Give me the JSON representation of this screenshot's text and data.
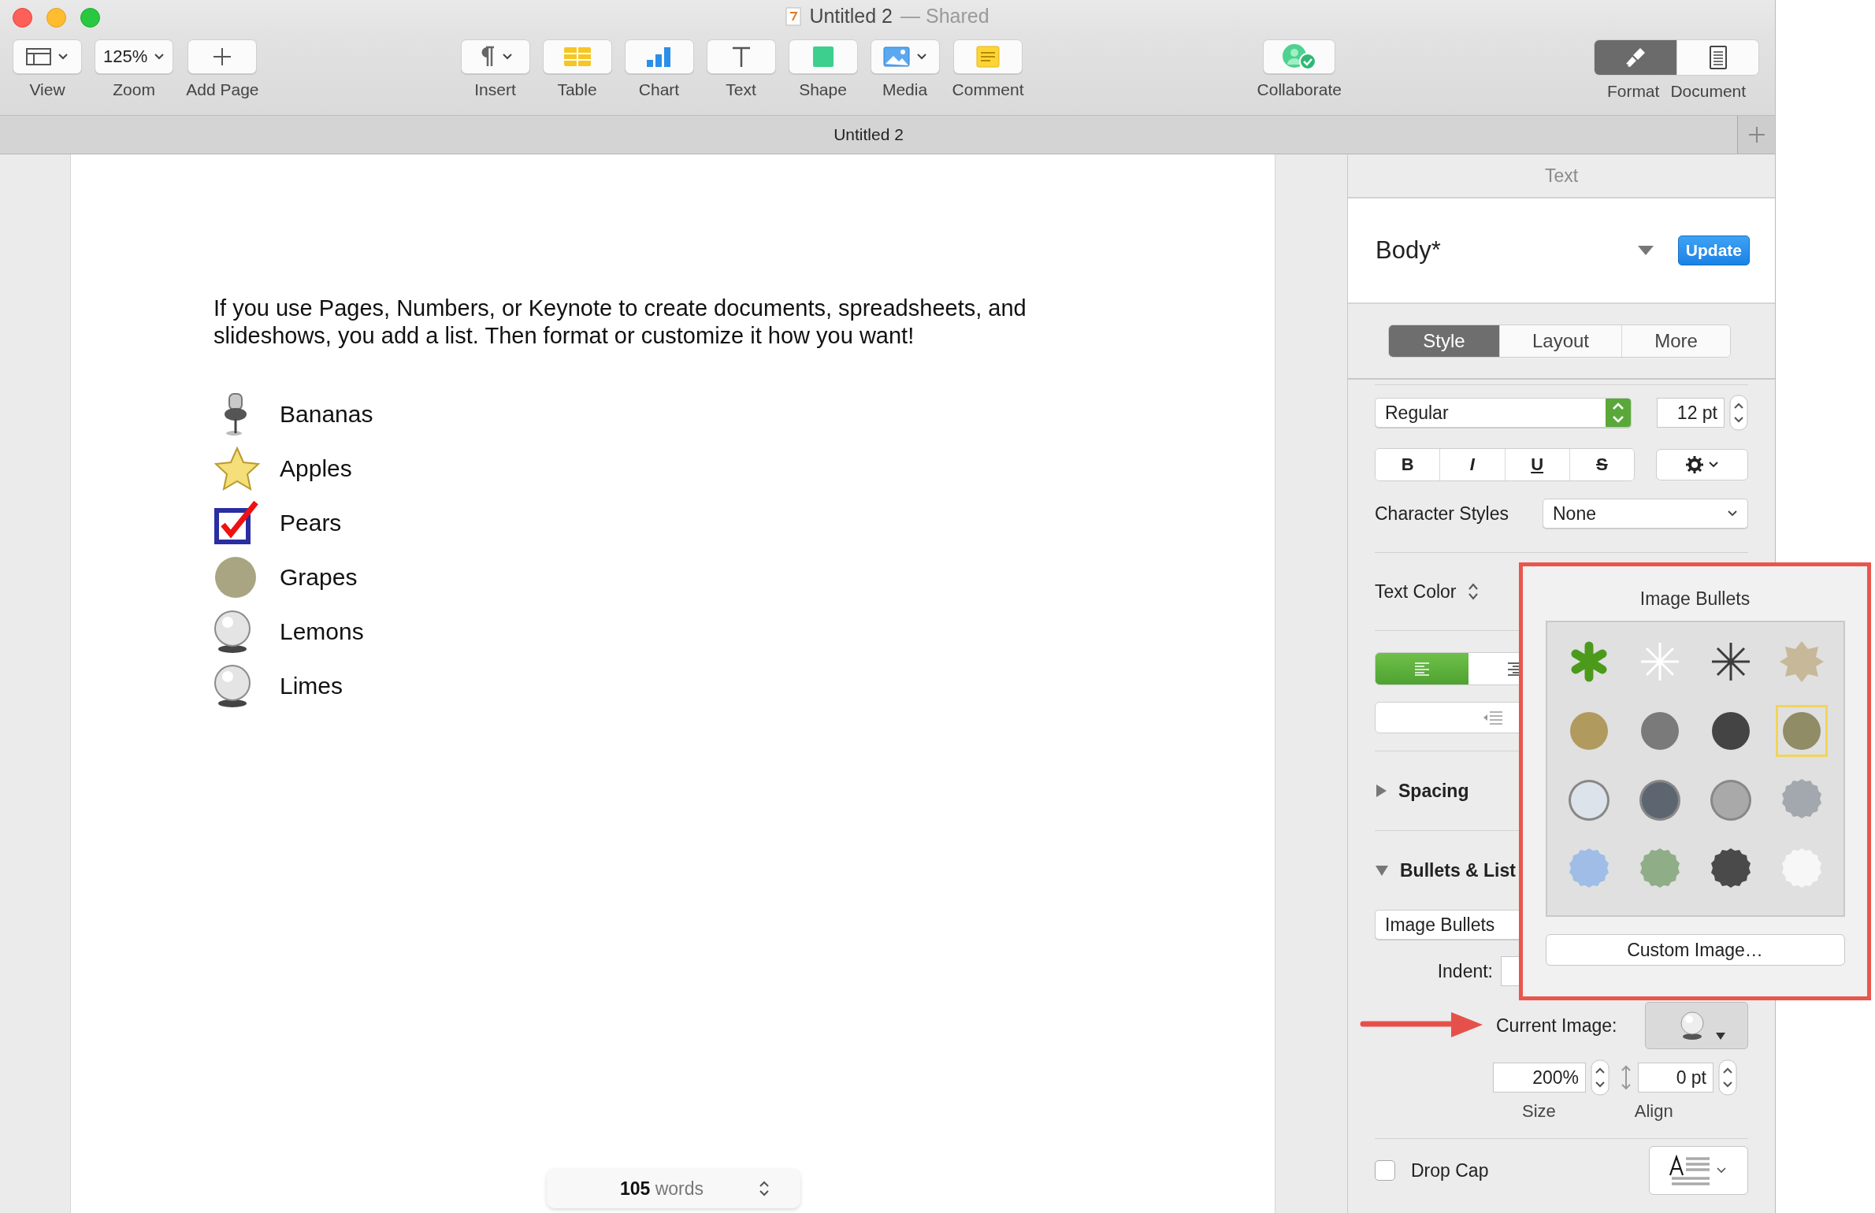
{
  "window": {
    "title": "Untitled 2",
    "subtitle": "— Shared"
  },
  "toolbar": [
    {
      "kind": "view",
      "label": "View"
    },
    {
      "kind": "zoom",
      "label": "Zoom",
      "value": "125%"
    },
    {
      "kind": "add_page",
      "label": "Add Page"
    },
    {
      "kind": "insert",
      "label": "Insert"
    },
    {
      "kind": "table",
      "label": "Table"
    },
    {
      "kind": "chart",
      "label": "Chart"
    },
    {
      "kind": "text",
      "label": "Text"
    },
    {
      "kind": "shape",
      "label": "Shape"
    },
    {
      "kind": "media",
      "label": "Media"
    },
    {
      "kind": "comment",
      "label": "Comment"
    },
    {
      "kind": "collaborate",
      "label": "Collaborate"
    }
  ],
  "inspector_switch": [
    {
      "kind": "format",
      "label": "Format",
      "selected": true
    },
    {
      "kind": "document",
      "label": "Document",
      "selected": false
    }
  ],
  "tab_bar": {
    "title": "Untitled 2"
  },
  "document": {
    "paragraph": "If you use Pages, Numbers, or Keynote to create documents, spreadsheets, and slideshows, you add a list. Then format or customize it how you want!",
    "list": [
      {
        "text": "Bananas",
        "kind": "pin"
      },
      {
        "text": "Apples",
        "kind": "star"
      },
      {
        "text": "Pears",
        "kind": "checkbox"
      },
      {
        "text": "Grapes",
        "kind": "disc"
      },
      {
        "text": "Lemons",
        "kind": "pearl"
      },
      {
        "text": "Limes",
        "kind": "pearl"
      }
    ],
    "word_count": "**105** words"
  },
  "sidebar": {
    "header": "Text",
    "paragraph_style": "Body*",
    "update_button": "Update",
    "tabs": [
      {
        "label": "Style",
        "selected": true
      },
      {
        "label": "Layout",
        "selected": false
      },
      {
        "label": "More",
        "selected": false
      }
    ],
    "font_style": "Regular",
    "font_size": "12 pt",
    "format_buttons": [
      {
        "kind": "bold",
        "label": "B"
      },
      {
        "kind": "italic",
        "label": "I"
      },
      {
        "kind": "underline",
        "label": "U"
      },
      {
        "kind": "strike",
        "label": "S"
      }
    ],
    "character_styles": {
      "label": "Character Styles",
      "value": "None"
    },
    "text_color": {
      "label": "Text Color"
    },
    "alignment": [
      {
        "selected": true
      },
      {
        "selected": false
      }
    ],
    "spacing": {
      "label": "Spacing",
      "expanded": false
    },
    "bullets": {
      "label": "Bullets & List",
      "expanded": true,
      "type": "Image Bullets",
      "indent_label": "Indent:",
      "current_image_label": "Current Image:",
      "size": "200%",
      "size_label": "Size",
      "align": "0 pt",
      "align_label": "Align"
    },
    "drop_cap": {
      "label": "Drop Cap",
      "checked": false
    }
  },
  "popover": {
    "title": "Image Bullets",
    "button": "Custom Image…",
    "items": [
      {
        "kind": "asterisk",
        "color": "#4c9a1c",
        "selected": false
      },
      {
        "kind": "sparkle",
        "color": "#ffffff",
        "selected": false
      },
      {
        "kind": "sparkle",
        "color": "#3c3c3c",
        "selected": false
      },
      {
        "kind": "star8",
        "color": "#c7b899",
        "selected": false
      },
      {
        "kind": "disc",
        "color": "#b09a5e",
        "selected": false
      },
      {
        "kind": "disc",
        "color": "#7a7a7a",
        "selected": false
      },
      {
        "kind": "disc",
        "color": "#444444",
        "selected": false
      },
      {
        "kind": "disc",
        "color": "#8f8c66",
        "selected": true
      },
      {
        "kind": "button",
        "color": "#dde3ea",
        "selected": false
      },
      {
        "kind": "button",
        "color": "#5d6670",
        "selected": false
      },
      {
        "kind": "button",
        "color": "#a9a9a9",
        "selected": false
      },
      {
        "kind": "texture",
        "color": "#a3a8ae",
        "selected": false
      },
      {
        "kind": "texture",
        "color": "#9fbde6",
        "selected": false
      },
      {
        "kind": "texture",
        "color": "#8fae88",
        "selected": false
      },
      {
        "kind": "texture",
        "color": "#4a4a4a",
        "selected": false
      },
      {
        "kind": "texture",
        "color": "#f7f7f7",
        "selected": false
      }
    ]
  }
}
